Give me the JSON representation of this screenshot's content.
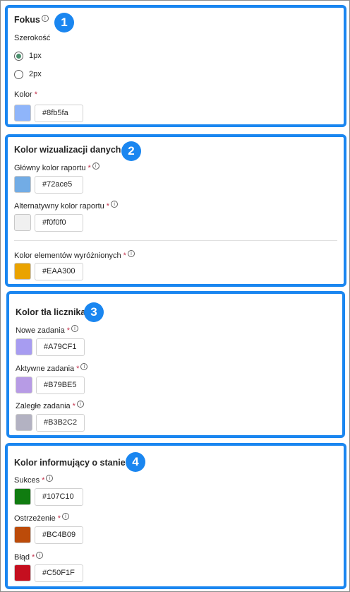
{
  "focus": {
    "title": "Fokus",
    "badge": "1",
    "width_label": "Szerokość",
    "options": [
      {
        "label": "1px",
        "selected": true
      },
      {
        "label": "2px",
        "selected": false
      }
    ],
    "color_label": "Kolor",
    "color_value": "#8fb5fa",
    "swatch": "#8fb5fa"
  },
  "data_viz": {
    "title": "Kolor wizualizacji danych",
    "badge": "2",
    "fields": [
      {
        "label": "Główny kolor raportu",
        "value": "#72ace5",
        "swatch": "#72ace5"
      },
      {
        "label": "Alternatywny kolor raportu",
        "value": "#f0f0f0",
        "swatch": "#f0f0f0"
      },
      {
        "label": "Kolor elementów wyróżnionych",
        "value": "#EAA300",
        "swatch": "#EAA300"
      }
    ]
  },
  "counter": {
    "title": "Kolor tła licznika",
    "badge": "3",
    "fields": [
      {
        "label": "Nowe zadania",
        "value": "#A79CF1",
        "swatch": "#A79CF1"
      },
      {
        "label": "Aktywne zadania",
        "value": "#B79BE5",
        "swatch": "#B79BE5"
      },
      {
        "label": "Zaległe zadania",
        "value": "#B3B2C2",
        "swatch": "#B3B2C2"
      }
    ]
  },
  "status": {
    "title": "Kolor informujący o stanie",
    "badge": "4",
    "fields": [
      {
        "label": "Sukces",
        "value": "#107C10",
        "swatch": "#107C10"
      },
      {
        "label": "Ostrzeżenie",
        "value": "#BC4B09",
        "swatch": "#BC4B09"
      },
      {
        "label": "Błąd",
        "value": "#C50F1F",
        "swatch": "#C50F1F"
      }
    ]
  },
  "ui": {
    "required_mark": "*",
    "info_glyph": "i",
    "accent": "#1a86f0",
    "radio_selected": "#4a8f6d"
  }
}
